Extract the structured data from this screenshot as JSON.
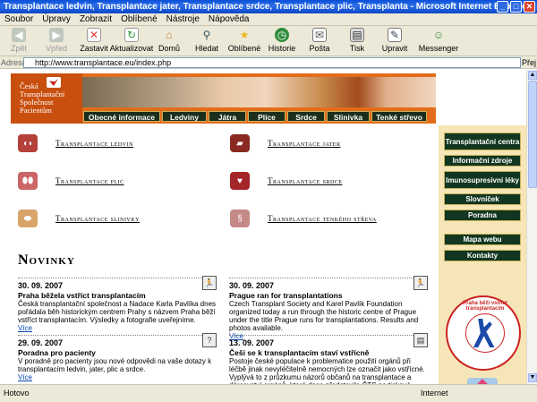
{
  "window": {
    "title": "Transplantace ledvin, Transplantace jater, Transplantace srdce, Transplantace plic, Transplanta - Microsoft Internet Explorer"
  },
  "menu": [
    "Soubor",
    "Úpravy",
    "Zobrazit",
    "Oblíbené",
    "Nástroje",
    "Nápověda"
  ],
  "toolbar": [
    {
      "label": "Zpět",
      "icon": "back-icon",
      "enabled": false
    },
    {
      "label": "Vpřed",
      "icon": "forward-icon",
      "enabled": false
    },
    {
      "label": "Zastavit",
      "icon": "stop-icon",
      "enabled": true
    },
    {
      "label": "Aktualizovat",
      "icon": "refresh-icon",
      "enabled": true
    },
    {
      "label": "Domů",
      "icon": "home-icon",
      "enabled": true
    },
    {
      "label": "Hledat",
      "icon": "search-icon",
      "enabled": true
    },
    {
      "label": "Oblíbené",
      "icon": "star-icon",
      "enabled": true
    },
    {
      "label": "Historie",
      "icon": "history-icon",
      "enabled": true
    },
    {
      "label": "Pošta",
      "icon": "mail-icon",
      "enabled": true
    },
    {
      "label": "Tisk",
      "icon": "print-icon",
      "enabled": true
    },
    {
      "label": "Upravit",
      "icon": "edit-icon",
      "enabled": true
    },
    {
      "label": "Messenger",
      "icon": "messenger-icon",
      "enabled": true
    }
  ],
  "address": {
    "label": "Adresa",
    "url": "http://www.transplantace.eu/index.php",
    "go": "Přej"
  },
  "site": {
    "logo_lines": [
      "Česká",
      "Transplantační",
      "Společnost",
      "Pacientům"
    ],
    "nav": [
      "Obecné informace",
      "Ledviny",
      "Játra",
      "Plíce",
      "Srdce",
      "Slinivka",
      "Tenké střevo"
    ],
    "organs": [
      {
        "label": "Transplantace ledvin",
        "icon": "kidney-icon",
        "color": "#b5413a"
      },
      {
        "label": "Transplantace jater",
        "icon": "liver-icon",
        "color": "#8b2a22"
      },
      {
        "label": "Transplantace plic",
        "icon": "lungs-icon",
        "color": "#c66"
      },
      {
        "label": "Transplantace srdce",
        "icon": "heart-organ-icon",
        "color": "#a3252a"
      },
      {
        "label": "Transplantace slinivky",
        "icon": "pancreas-icon",
        "color": "#d9a46a"
      },
      {
        "label": "Transplantace tenkého střeva",
        "icon": "intestine-icon",
        "color": "#c48a86"
      }
    ],
    "news_title": "Novinky",
    "news": [
      {
        "date": "30. 09. 2007",
        "headline": "Praha běžela vstříct transplantacím",
        "text": "Česká transplantační společnost a Nadace Karla Pavlíka dnes pořádala běh historickým centrem Prahy s názvem Praha běží vstříct transplantacím. Výsledky a fotografie uveřejníme.",
        "more": "Více",
        "icon": "runner-icon"
      },
      {
        "date": "30. 09. 2007",
        "headline": "Prague ran for transplantations",
        "text": "Czech Transplant Society and Karel Pavlík Foundation organized today a run through the historic centre of Prague under the title Prague runs for transplantations. Results and photos available.",
        "more": "Více",
        "icon": "runner-icon"
      },
      {
        "date": "29. 09. 2007",
        "headline": "Poradna pro pacienty",
        "text": "V poradně pro pacienty jsou nové odpovědi na vaše dotazy k transplantacím ledvin, jater, plic a srdce.",
        "more": "Více",
        "icon": "question-icon"
      },
      {
        "date": "13. 09. 2007",
        "headline": "Češi se k transplantacím staví vstřícně",
        "text": "Postoje české populace k problematice použití orgánů při léčbě jinak nevyléčitelně nemocných lze označit jako vstřícné. Vyplývá to z průzkumu názorů občanů na transplantace a dárcovství orgánů, které dnes představila ČTS na tiskové",
        "more": "",
        "icon": "document-icon"
      }
    ],
    "sidebar": [
      "Transplantační centra",
      "Informační zdroje",
      "Imunosupresivní léky",
      "Slovníček",
      "Poradna",
      "Mapa webu",
      "Kontakty"
    ],
    "seal_text": "Praha běží vstříct transplantacím"
  },
  "status": {
    "left": "Hotovo",
    "right": "Internet"
  }
}
